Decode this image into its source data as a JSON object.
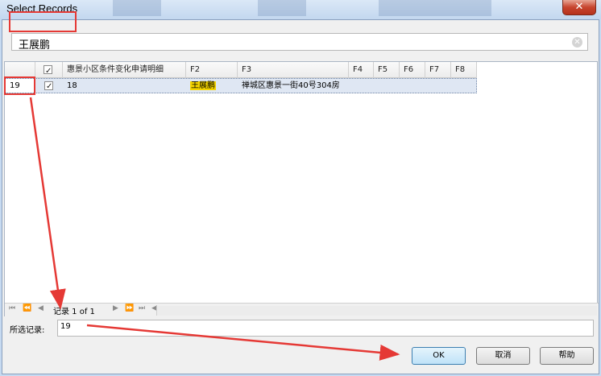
{
  "window": {
    "title": "Select Records",
    "close_glyph": "✕"
  },
  "search": {
    "value": "王展鹏",
    "clear_glyph": "✕"
  },
  "grid": {
    "columns": [
      "",
      "",
      "惠景小区条件变化申请明细",
      "F2",
      "F3",
      "F4",
      "F5",
      "F6",
      "F7",
      "F8"
    ],
    "rows": [
      {
        "row_number": "19",
        "checked": true,
        "c1": "18",
        "f2": "王展鹏",
        "f3": "禅城区惠景一街40号304房"
      }
    ]
  },
  "pager": {
    "icons": [
      "first-icon",
      "prev-page-icon",
      "prev-icon"
    ],
    "label": "记录 1 of 1",
    "icons_after": [
      "next-icon",
      "next-page-icon",
      "last-icon",
      "scroll-left-icon"
    ]
  },
  "selection": {
    "label": "所选记录:",
    "value": "19"
  },
  "buttons": {
    "ok": "OK",
    "cancel": "取消",
    "help": "帮助"
  },
  "colors": {
    "annotation": "#e53935",
    "highlight": "#f5d400"
  }
}
